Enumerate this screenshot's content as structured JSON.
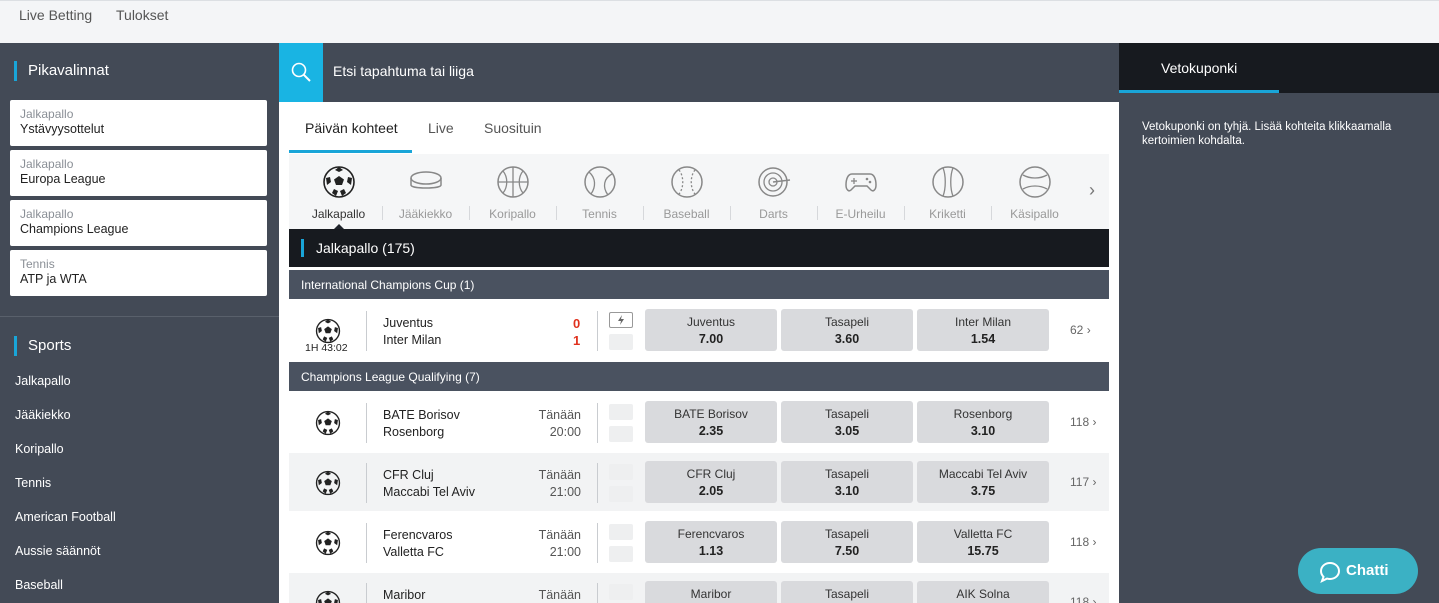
{
  "topnav": {
    "live_betting": "Live Betting",
    "results": "Tulokset"
  },
  "sidebar": {
    "quick_title": "Pikavalinnat",
    "quick": [
      {
        "cat": "Jalkapallo",
        "league": "Ystävyysottelut"
      },
      {
        "cat": "Jalkapallo",
        "league": "Europa League"
      },
      {
        "cat": "Jalkapallo",
        "league": "Champions League"
      },
      {
        "cat": "Tennis",
        "league": "ATP ja WTA"
      }
    ],
    "sports_title": "Sports",
    "sports": [
      "Jalkapallo",
      "Jääkiekko",
      "Koripallo",
      "Tennis",
      "American Football",
      "Aussie säännöt",
      "Baseball"
    ]
  },
  "search": {
    "placeholder": "Etsi tapahtuma tai liiga"
  },
  "tabs": [
    "Päivän kohteet",
    "Live",
    "Suosituin"
  ],
  "sport_icons": [
    "Jalkapallo",
    "Jääkiekko",
    "Koripallo",
    "Tennis",
    "Baseball",
    "Darts",
    "E-Urheilu",
    "Kriketti",
    "Käsipallo"
  ],
  "section": {
    "title": "Jalkapallo (175)"
  },
  "leagues": {
    "icc": "International Champions Cup (1)",
    "clq": "Champions League Qualifying (7)"
  },
  "matches": [
    {
      "home": "Juventus",
      "away": "Inter Milan",
      "score_home": "0",
      "score_away": "1",
      "clock": "1H 43:02",
      "odds": [
        {
          "n": "Juventus",
          "v": "7.00"
        },
        {
          "n": "Tasapeli",
          "v": "3.60"
        },
        {
          "n": "Inter Milan",
          "v": "1.54"
        }
      ],
      "more": "62"
    },
    {
      "home": "BATE Borisov",
      "away": "Rosenborg",
      "day": "Tänään",
      "time": "20:00",
      "odds": [
        {
          "n": "BATE Borisov",
          "v": "2.35"
        },
        {
          "n": "Tasapeli",
          "v": "3.05"
        },
        {
          "n": "Rosenborg",
          "v": "3.10"
        }
      ],
      "more": "118"
    },
    {
      "home": "CFR Cluj",
      "away": "Maccabi Tel Aviv",
      "day": "Tänään",
      "time": "21:00",
      "odds": [
        {
          "n": "CFR Cluj",
          "v": "2.05"
        },
        {
          "n": "Tasapeli",
          "v": "3.10"
        },
        {
          "n": "Maccabi Tel Aviv",
          "v": "3.75"
        }
      ],
      "more": "117"
    },
    {
      "home": "Ferencvaros",
      "away": "Valletta FC",
      "day": "Tänään",
      "time": "21:00",
      "odds": [
        {
          "n": "Ferencvaros",
          "v": "1.13"
        },
        {
          "n": "Tasapeli",
          "v": "7.50"
        },
        {
          "n": "Valletta FC",
          "v": "15.75"
        }
      ],
      "more": "118"
    },
    {
      "home": "Maribor",
      "day": "Tänään",
      "odds": [
        {
          "n": "Maribor"
        },
        {
          "n": "Tasapeli"
        },
        {
          "n": "AIK Solna"
        }
      ],
      "more": "118"
    }
  ],
  "betslip": {
    "title": "Vetokuponki",
    "empty": "Vetokuponki on tyhjä. Lisää kohteita klikkaamalla kertoimien kohdalta."
  },
  "chat": {
    "label": "Chatti"
  },
  "colors": {
    "accent": "#19a5d8",
    "search_button": "#19b4e3",
    "chat": "#3bb1c4",
    "score": "#e0311d"
  }
}
